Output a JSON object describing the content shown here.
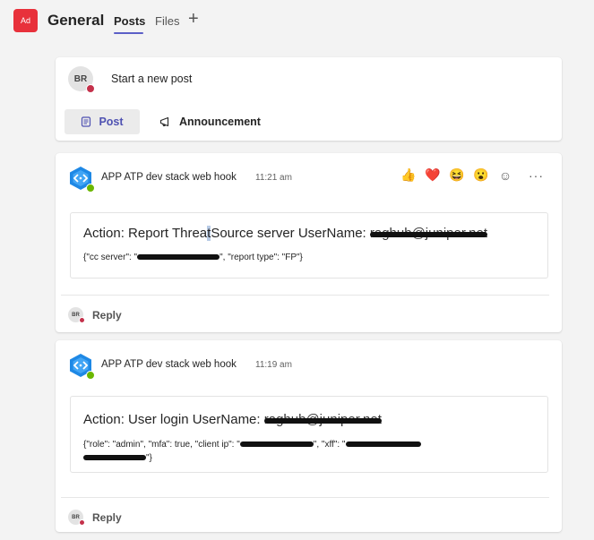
{
  "header": {
    "app_badge": "Ad",
    "channel_title": "General",
    "tabs": [
      {
        "label": "Posts",
        "active": true
      },
      {
        "label": "Files",
        "active": false
      }
    ],
    "add_tab_icon": "+"
  },
  "compose": {
    "avatar_initials": "BR",
    "placeholder": "Start a new post",
    "post_button": "Post",
    "announcement_button": "Announcement"
  },
  "messages": [
    {
      "sender": "APP ATP dev stack web hook",
      "time": "11:21 am",
      "reactions": [
        "👍",
        "❤️",
        "😆",
        "😮",
        "☺"
      ],
      "more": "···",
      "card": {
        "title_prefix": "Action: Report Threa",
        "title_highlight": "t",
        "title_mid": "Source server UserName:",
        "title_redacted": "raghub@juniper.net",
        "body_start": "{\"cc server\": \"",
        "body_mid": "\", \"report type\": \"FP\"}"
      },
      "reply_avatar": "BR",
      "reply_label": "Reply"
    },
    {
      "sender": "APP ATP dev stack web hook",
      "time": "11:19 am",
      "card": {
        "title_prefix": "Action: User login UserName:",
        "title_redacted": "raghub@juniper.net",
        "body_start": "{\"role\": \"admin\", \"mfa\": true, \"client ip\": \"",
        "body_mid": "\", \"xff\": \"",
        "body_end": "\"}"
      },
      "reply_avatar": "BR",
      "reply_label": "Reply"
    }
  ],
  "colors": {
    "accent": "#5b5fc7",
    "badge": "#e8313b",
    "presence_dnd": "#c4314b",
    "presence_available": "#6bb700",
    "bot_icon": "#1e88e5"
  }
}
